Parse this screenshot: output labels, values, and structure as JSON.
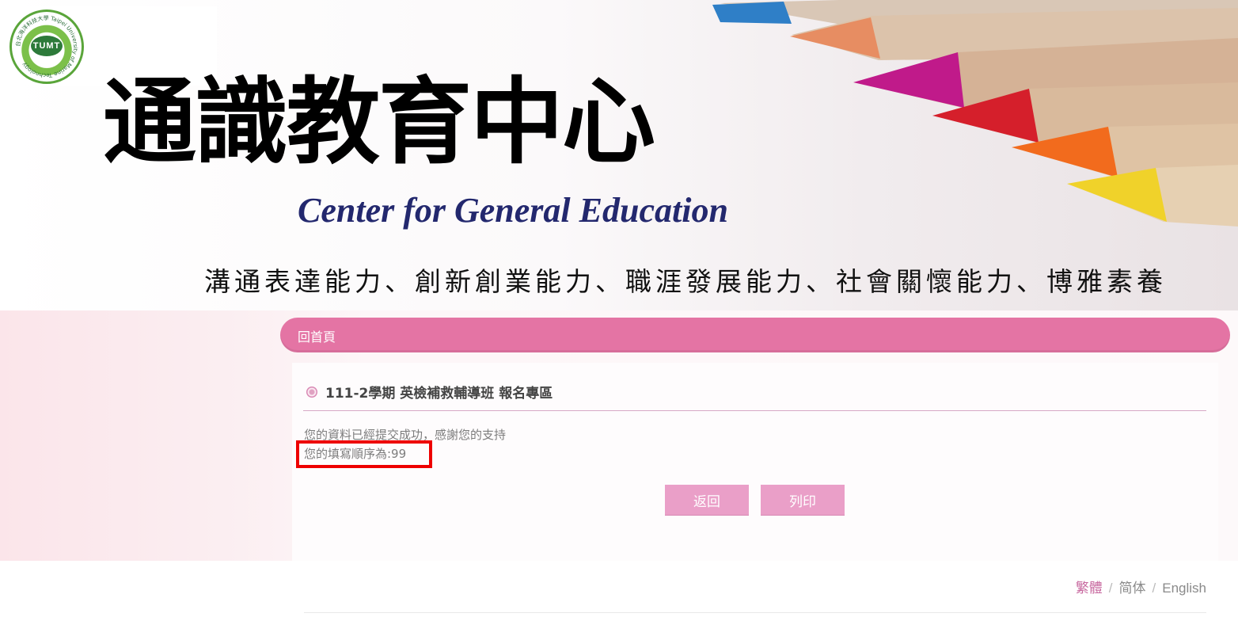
{
  "banner": {
    "title_zh": "通識教育中心",
    "title_en": "Center for General Education",
    "tagline": "溝通表達能力、創新創業能力、職涯發展能力、社會關懷能力、博雅素養",
    "logo": {
      "ring_text": "台北海洋科技大學 Taipei University of Marine Technology",
      "core_text": "TUMT"
    }
  },
  "nav": {
    "home_label": "回首頁",
    "bar_color": "#e474a4"
  },
  "content": {
    "heading": "111-2學期 英檢補救輔導班 報名專區",
    "message": "您的資料已經提交成功，感謝您的支持",
    "order_text": "您的填寫順序為:99",
    "buttons": {
      "back_label": "返回",
      "print_label": "列印"
    }
  },
  "footer": {
    "languages": [
      {
        "label": "繁體",
        "active": true
      },
      {
        "label": "简体",
        "active": false
      },
      {
        "label": "English",
        "active": false
      }
    ],
    "separator": "/"
  },
  "colors": {
    "accent_pink": "#e474a4",
    "button_pink": "#ea9fc8",
    "highlight_red": "#ee0000",
    "title_navy": "#23286e"
  }
}
